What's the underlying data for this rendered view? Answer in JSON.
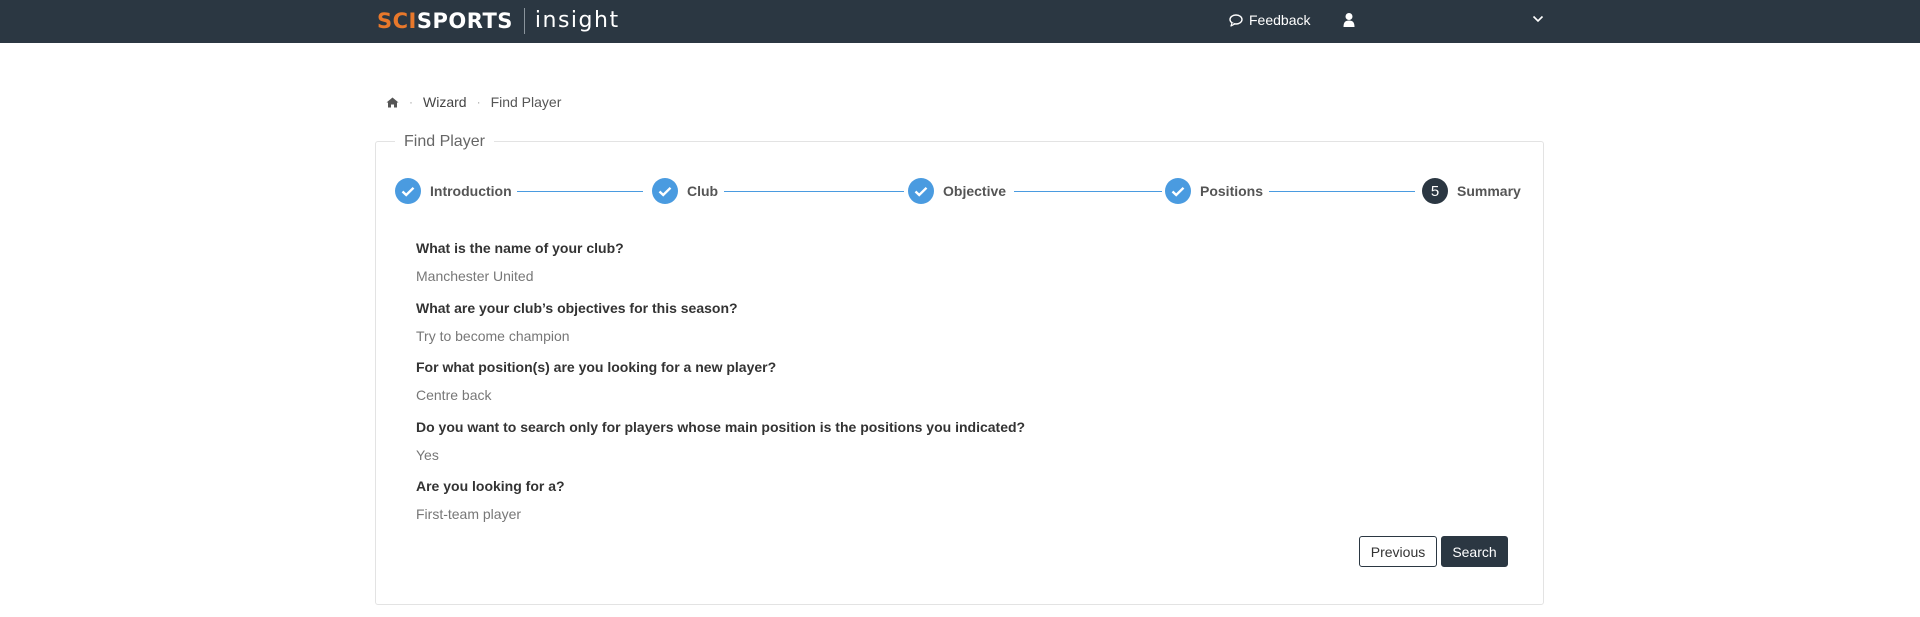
{
  "header": {
    "logo_part1": "SCI",
    "logo_part2": "SPORTS",
    "logo_sub": "insight",
    "feedback_label": "Feedback",
    "user_icon": "user-icon",
    "caret_icon": "chevron-down-icon"
  },
  "breadcrumb": {
    "home_icon": "home-icon",
    "items": [
      "Wizard",
      "Find Player"
    ]
  },
  "panel": {
    "title": "Find Player"
  },
  "steps": [
    {
      "label": "Introduction",
      "state": "done"
    },
    {
      "label": "Club",
      "state": "done"
    },
    {
      "label": "Objective",
      "state": "done"
    },
    {
      "label": "Positions",
      "state": "done"
    },
    {
      "label": "Summary",
      "state": "current",
      "number": "5"
    }
  ],
  "summary": [
    {
      "question": "What is the name of your club?",
      "answer": "Manchester United"
    },
    {
      "question": "What are your club’s objectives for this season?",
      "answer": "Try to become champion"
    },
    {
      "question": "For what position(s) are you looking for a new player?",
      "answer": "Centre back"
    },
    {
      "question": "Do you want to search only for players whose main position is the positions you indicated?",
      "answer": "Yes"
    },
    {
      "question": "Are you looking for a?",
      "answer": "First-team player"
    }
  ],
  "buttons": {
    "previous": "Previous",
    "search": "Search"
  },
  "colors": {
    "navbar": "#2b3742",
    "accent_orange": "#e8782b",
    "step_blue": "#4a9be0"
  }
}
